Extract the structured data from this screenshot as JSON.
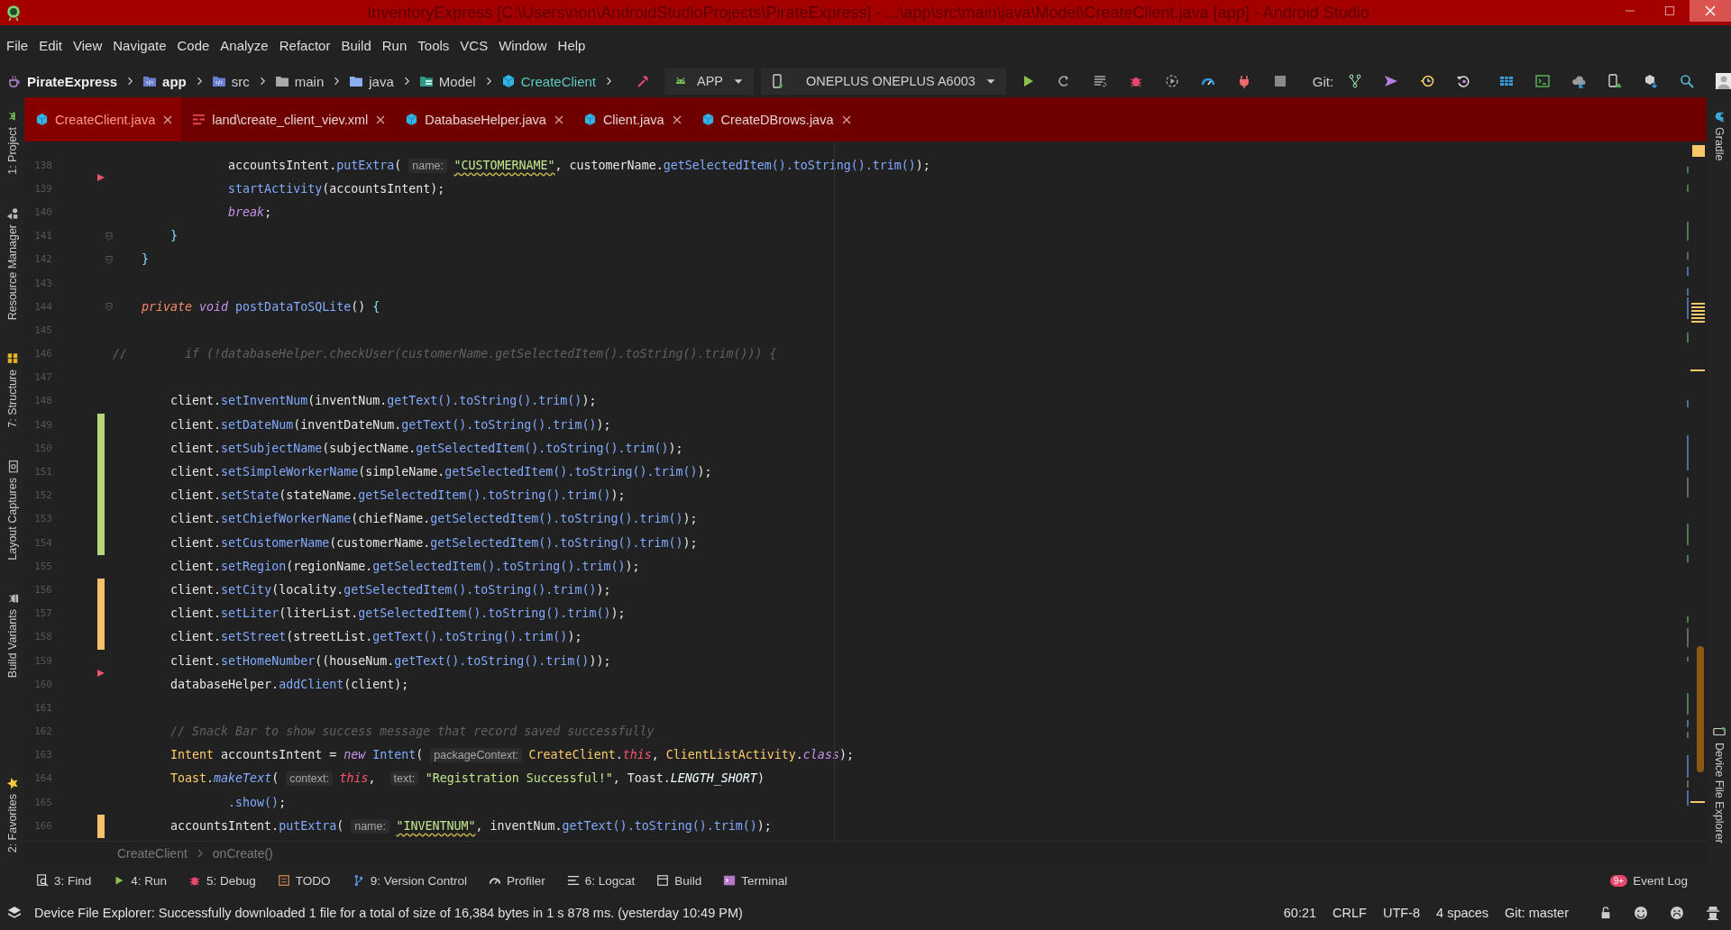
{
  "window": {
    "title": "InventoryExpress [C:\\Users\\non\\AndroidStudioProjects\\PirateExpress] - ...\\app\\src\\main\\java\\Model\\CreateClient.java [app] - Android Studio"
  },
  "menu": [
    "File",
    "Edit",
    "View",
    "Navigate",
    "Code",
    "Analyze",
    "Refactor",
    "Build",
    "Run",
    "Tools",
    "VCS",
    "Window",
    "Help"
  ],
  "navigation_bar": {
    "breadcrumbs": [
      {
        "label": "PirateExpress",
        "kind": "project"
      },
      {
        "label": "app",
        "kind": "module"
      },
      {
        "label": "src",
        "kind": "source"
      },
      {
        "label": "main",
        "kind": "folder"
      },
      {
        "label": "java",
        "kind": "source-root"
      },
      {
        "label": "Model",
        "kind": "package"
      },
      {
        "label": "CreateClient",
        "kind": "class"
      }
    ],
    "run_config": "APP",
    "device": "ONEPLUS ONEPLUS A6003",
    "git_label": "Git:"
  },
  "left_tool_windows": [
    {
      "label": "1: Project",
      "kind": "project"
    },
    {
      "label": "Resource Manager",
      "kind": "resources"
    },
    {
      "label": "7: Structure",
      "kind": "structure"
    },
    {
      "label": "Layout Captures",
      "kind": "captures"
    },
    {
      "label": "Build Variants",
      "kind": "variants"
    },
    {
      "label": "2: Favorites",
      "kind": "favorites"
    }
  ],
  "right_tool_windows": [
    {
      "label": "Gradle",
      "kind": "gradle"
    },
    {
      "label": "Device File Explorer",
      "kind": "device"
    }
  ],
  "editor_tabs": [
    {
      "label": "CreateClient.java",
      "kind": "java",
      "selected": true
    },
    {
      "label": "land\\create_client_viev.xml",
      "kind": "xml",
      "selected": false
    },
    {
      "label": "DatabaseHelper.java",
      "kind": "java",
      "selected": false
    },
    {
      "label": "Client.java",
      "kind": "java",
      "selected": false
    },
    {
      "label": "CreateDBrows.java",
      "kind": "java",
      "selected": false
    }
  ],
  "editor": {
    "lines": [
      {
        "number": "138",
        "added": false,
        "modified": false,
        "deleted": true,
        "fold": false,
        "tokens": [
          {
            "kind": "text",
            "text": "                accountsIntent."
          },
          {
            "kind": "method",
            "text": "putExtra"
          },
          {
            "kind": "text",
            "text": "( "
          },
          {
            "kind": "hint",
            "text": "name:"
          },
          {
            "kind": "string-warn",
            "text": "\"CUSTOMERNAME\""
          },
          {
            "kind": "text",
            "text": ", customerName."
          },
          {
            "kind": "method",
            "text": "getSelectedItem().toString().trim()"
          },
          {
            "kind": "text",
            "text": ");"
          }
        ]
      },
      {
        "number": "139",
        "added": false,
        "modified": false,
        "deleted": false,
        "fold": false,
        "tokens": [
          {
            "kind": "method",
            "text": "                startActivity"
          },
          {
            "kind": "text",
            "text": "(accountsIntent);"
          }
        ]
      },
      {
        "number": "140",
        "added": false,
        "modified": false,
        "deleted": false,
        "fold": false,
        "tokens": [
          {
            "kind": "keyword",
            "text": "                break"
          },
          {
            "kind": "text",
            "text": ";"
          }
        ]
      },
      {
        "number": "141",
        "added": false,
        "modified": false,
        "deleted": false,
        "fold": true,
        "tokens": [
          {
            "kind": "punct",
            "text": "        }"
          }
        ]
      },
      {
        "number": "142",
        "added": false,
        "modified": false,
        "deleted": false,
        "fold": true,
        "tokens": [
          {
            "kind": "punct",
            "text": "    }"
          }
        ]
      },
      {
        "number": "143",
        "added": false,
        "modified": false,
        "deleted": false,
        "fold": false
      },
      {
        "number": "144",
        "added": false,
        "modified": false,
        "deleted": false,
        "fold": true,
        "tokens": [
          {
            "kind": "modifier",
            "text": "    private"
          },
          {
            "kind": "keyword",
            "text": " void"
          },
          {
            "kind": "method",
            "text": " postDataToSQLite"
          },
          {
            "kind": "text",
            "text": "() "
          },
          {
            "kind": "punct",
            "text": "{"
          }
        ]
      },
      {
        "number": "145",
        "added": false,
        "modified": false,
        "deleted": false,
        "fold": false
      },
      {
        "number": "146",
        "added": false,
        "modified": false,
        "deleted": false,
        "fold": false,
        "tokens": [
          {
            "kind": "comment",
            "text": "//        if (!databaseHelper.checkUser(customerName.getSelectedItem().toString().trim())) {"
          }
        ]
      },
      {
        "number": "147",
        "added": false,
        "modified": false,
        "deleted": false,
        "fold": false
      },
      {
        "number": "148",
        "added": false,
        "modified": false,
        "deleted": false,
        "fold": false,
        "tokens": [
          {
            "kind": "text",
            "text": "        client."
          },
          {
            "kind": "method",
            "text": "setInventNum"
          },
          {
            "kind": "text",
            "text": "(inventNum."
          },
          {
            "kind": "method",
            "text": "getText().toString().trim()"
          },
          {
            "kind": "text",
            "text": ");"
          }
        ]
      },
      {
        "number": "149",
        "added": true,
        "modified": false,
        "deleted": false,
        "fold": false,
        "tokens": [
          {
            "kind": "text",
            "text": "        client."
          },
          {
            "kind": "method",
            "text": "setDateNum"
          },
          {
            "kind": "text",
            "text": "(inventDateNum."
          },
          {
            "kind": "method",
            "text": "getText().toString().trim()"
          },
          {
            "kind": "text",
            "text": ");"
          }
        ]
      },
      {
        "number": "150",
        "added": true,
        "modified": false,
        "deleted": false,
        "fold": false,
        "tokens": [
          {
            "kind": "text",
            "text": "        client."
          },
          {
            "kind": "method",
            "text": "setSubjectName"
          },
          {
            "kind": "text",
            "text": "(subjectName."
          },
          {
            "kind": "method",
            "text": "getSelectedItem().toString().trim()"
          },
          {
            "kind": "text",
            "text": ");"
          }
        ]
      },
      {
        "number": "151",
        "added": true,
        "modified": false,
        "deleted": false,
        "fold": false,
        "tokens": [
          {
            "kind": "text",
            "text": "        client."
          },
          {
            "kind": "method",
            "text": "setSimpleWorkerName"
          },
          {
            "kind": "text",
            "text": "(simpleName."
          },
          {
            "kind": "method",
            "text": "getSelectedItem().toString().trim()"
          },
          {
            "kind": "text",
            "text": ");"
          }
        ]
      },
      {
        "number": "152",
        "added": true,
        "modified": false,
        "deleted": false,
        "fold": false,
        "tokens": [
          {
            "kind": "text",
            "text": "        client."
          },
          {
            "kind": "method",
            "text": "setState"
          },
          {
            "kind": "text",
            "text": "(stateName."
          },
          {
            "kind": "method",
            "text": "getSelectedItem().toString().trim()"
          },
          {
            "kind": "text",
            "text": ");"
          }
        ]
      },
      {
        "number": "153",
        "added": true,
        "modified": false,
        "deleted": false,
        "fold": false,
        "tokens": [
          {
            "kind": "text",
            "text": "        client."
          },
          {
            "kind": "method",
            "text": "setChiefWorkerName"
          },
          {
            "kind": "text",
            "text": "(chiefName."
          },
          {
            "kind": "method",
            "text": "getSelectedItem().toString().trim()"
          },
          {
            "kind": "text",
            "text": ");"
          }
        ]
      },
      {
        "number": "154",
        "added": true,
        "modified": false,
        "deleted": false,
        "fold": false,
        "tokens": [
          {
            "kind": "text",
            "text": "        client."
          },
          {
            "kind": "method",
            "text": "setCustomerName"
          },
          {
            "kind": "text",
            "text": "(customerName."
          },
          {
            "kind": "method",
            "text": "getSelectedItem().toString().trim()"
          },
          {
            "kind": "text",
            "text": ");"
          }
        ]
      },
      {
        "number": "155",
        "added": false,
        "modified": false,
        "deleted": false,
        "fold": false,
        "tokens": [
          {
            "kind": "text",
            "text": "        client."
          },
          {
            "kind": "method",
            "text": "setRegion"
          },
          {
            "kind": "text",
            "text": "(regionName."
          },
          {
            "kind": "method",
            "text": "getSelectedItem().toString().trim()"
          },
          {
            "kind": "text",
            "text": ");"
          }
        ]
      },
      {
        "number": "156",
        "added": false,
        "modified": true,
        "deleted": false,
        "fold": false,
        "tokens": [
          {
            "kind": "text",
            "text": "        client."
          },
          {
            "kind": "method",
            "text": "setCity"
          },
          {
            "kind": "text",
            "text": "(locality."
          },
          {
            "kind": "method",
            "text": "getSelectedItem().toString().trim()"
          },
          {
            "kind": "text",
            "text": ");"
          }
        ]
      },
      {
        "number": "157",
        "added": false,
        "modified": true,
        "deleted": false,
        "fold": false,
        "tokens": [
          {
            "kind": "text",
            "text": "        client."
          },
          {
            "kind": "method",
            "text": "setLiter"
          },
          {
            "kind": "text",
            "text": "(literList."
          },
          {
            "kind": "method",
            "text": "getSelectedItem().toString().trim()"
          },
          {
            "kind": "text",
            "text": ");"
          }
        ]
      },
      {
        "number": "158",
        "added": false,
        "modified": true,
        "deleted": false,
        "fold": false,
        "tokens": [
          {
            "kind": "text",
            "text": "        client."
          },
          {
            "kind": "method",
            "text": "setStreet"
          },
          {
            "kind": "text",
            "text": "(streetList."
          },
          {
            "kind": "method",
            "text": "getText().toString().trim()"
          },
          {
            "kind": "text",
            "text": ");"
          }
        ]
      },
      {
        "number": "159",
        "added": false,
        "modified": false,
        "deleted": true,
        "fold": false,
        "tokens": [
          {
            "kind": "text",
            "text": "        client."
          },
          {
            "kind": "method",
            "text": "setHomeNumber"
          },
          {
            "kind": "text",
            "text": "((houseNum."
          },
          {
            "kind": "method",
            "text": "getText().toString().trim()"
          },
          {
            "kind": "text",
            "text": "));"
          }
        ]
      },
      {
        "number": "160",
        "added": false,
        "modified": false,
        "deleted": false,
        "fold": false,
        "tokens": [
          {
            "kind": "text",
            "text": "        databaseHelper."
          },
          {
            "kind": "method",
            "text": "addClient"
          },
          {
            "kind": "text",
            "text": "(client);"
          }
        ]
      },
      {
        "number": "161",
        "added": false,
        "modified": false,
        "deleted": false,
        "fold": false
      },
      {
        "number": "162",
        "added": false,
        "modified": false,
        "deleted": false,
        "fold": false,
        "tokens": [
          {
            "kind": "comment",
            "text": "        // Snack Bar to show success message that record saved successfully"
          }
        ]
      },
      {
        "number": "163",
        "added": false,
        "modified": false,
        "deleted": false,
        "fold": false,
        "tokens": [
          {
            "kind": "type",
            "text": "        Intent"
          },
          {
            "kind": "text",
            "text": " accountsIntent = "
          },
          {
            "kind": "keyword",
            "text": "new"
          },
          {
            "kind": "method",
            "text": " Intent"
          },
          {
            "kind": "text",
            "text": "( "
          },
          {
            "kind": "hint",
            "text": "packageContext:"
          },
          {
            "kind": "type",
            "text": "CreateClient"
          },
          {
            "kind": "text",
            "text": "."
          },
          {
            "kind": "this",
            "text": "this"
          },
          {
            "kind": "text",
            "text": ", "
          },
          {
            "kind": "type",
            "text": "ClientListActivity"
          },
          {
            "kind": "text",
            "text": "."
          },
          {
            "kind": "keyword",
            "text": "class"
          },
          {
            "kind": "text",
            "text": ");"
          }
        ]
      },
      {
        "number": "164",
        "added": false,
        "modified": false,
        "deleted": false,
        "fold": false,
        "tokens": [
          {
            "kind": "type",
            "text": "        Toast"
          },
          {
            "kind": "text",
            "text": "."
          },
          {
            "kind": "static",
            "text": "makeText"
          },
          {
            "kind": "text",
            "text": "( "
          },
          {
            "kind": "hint",
            "text": "context:"
          },
          {
            "kind": "this",
            "text": "this"
          },
          {
            "kind": "text",
            "text": ",  "
          },
          {
            "kind": "hint",
            "text": "text:"
          },
          {
            "kind": "string",
            "text": "\"Registration Successful!\""
          },
          {
            "kind": "text",
            "text": ", Toast."
          },
          {
            "kind": "constant",
            "text": "LENGTH_SHORT"
          },
          {
            "kind": "text",
            "text": ")"
          }
        ]
      },
      {
        "number": "165",
        "added": false,
        "modified": false,
        "deleted": false,
        "fold": false,
        "tokens": [
          {
            "kind": "method",
            "text": "                .show()"
          },
          {
            "kind": "text",
            "text": ";"
          }
        ]
      },
      {
        "number": "166",
        "added": false,
        "modified": true,
        "deleted": false,
        "fold": false,
        "tokens": [
          {
            "kind": "text",
            "text": "        accountsIntent."
          },
          {
            "kind": "method",
            "text": "putExtra"
          },
          {
            "kind": "text",
            "text": "( "
          },
          {
            "kind": "hint",
            "text": "name:"
          },
          {
            "kind": "string-warn",
            "text": "\"INVENTNUM\""
          },
          {
            "kind": "text",
            "text": ", inventNum."
          },
          {
            "kind": "method",
            "text": "getText().toString().trim()"
          },
          {
            "kind": "text",
            "text": ");"
          }
        ]
      }
    ]
  },
  "breadcrumb": [
    "CreateClient",
    "onCreate()"
  ],
  "tool_buttons": [
    {
      "label": "3: Find",
      "kind": "find"
    },
    {
      "label": "4: Run",
      "kind": "run"
    },
    {
      "label": "5: Debug",
      "kind": "debug"
    },
    {
      "label": "TODO",
      "kind": "todo"
    },
    {
      "label": "9: Version Control",
      "kind": "vcs"
    },
    {
      "label": "Profiler",
      "kind": "profiler"
    },
    {
      "label": "6: Logcat",
      "kind": "logcat"
    },
    {
      "label": "Build",
      "kind": "build"
    },
    {
      "label": "Terminal",
      "kind": "terminal"
    }
  ],
  "event_log": {
    "label": "Event Log",
    "badge": "9+"
  },
  "status_bar": {
    "message": "Device File Explorer: Successfully downloaded 1 file for a total of size of 16,384 bytes in 1 s 878 ms. (yesterday 10:49 PM)",
    "position": "60:21",
    "line_separator": "CRLF",
    "encoding": "UTF-8",
    "indent": "4 spaces",
    "vcs": "Git: master"
  }
}
